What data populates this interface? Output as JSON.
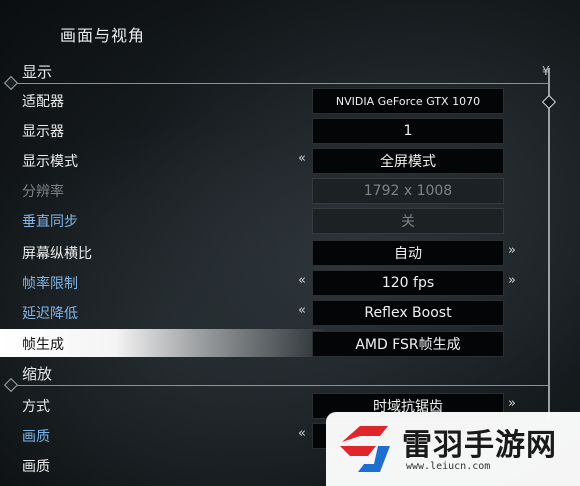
{
  "title": "画面与视角",
  "sections": {
    "display": "显示",
    "scaling": "缩放"
  },
  "rows": [
    {
      "label": "适配器",
      "value": "NVIDIA GeForce GTX 1070"
    },
    {
      "label": "显示器",
      "value": "1"
    },
    {
      "label": "显示模式",
      "value": "全屏模式"
    },
    {
      "label": "分辨率",
      "value": "1792 x 1008"
    },
    {
      "label": "垂直同步",
      "value": "关"
    },
    {
      "label": "屏幕纵横比",
      "value": "自动"
    },
    {
      "label": "帧率限制",
      "value": "120 fps"
    },
    {
      "label": "延迟降低",
      "value": "Reflex Boost"
    },
    {
      "label": "帧生成",
      "value": "AMD FSR帧生成"
    },
    {
      "label": "方式",
      "value": "时域抗锯齿"
    },
    {
      "label": "画质",
      "value": ""
    },
    {
      "label": "画质",
      "value": ""
    }
  ],
  "arrows": {
    "left": "«",
    "right": "»"
  },
  "watermark": {
    "name": "雷羽手游网",
    "url": "www.leiucn.com"
  },
  "colors": {
    "accent": "#7fb4ea",
    "disabled": "#7c8287",
    "logo_red": "#e0262d",
    "logo_blue": "#1f6fd1"
  }
}
